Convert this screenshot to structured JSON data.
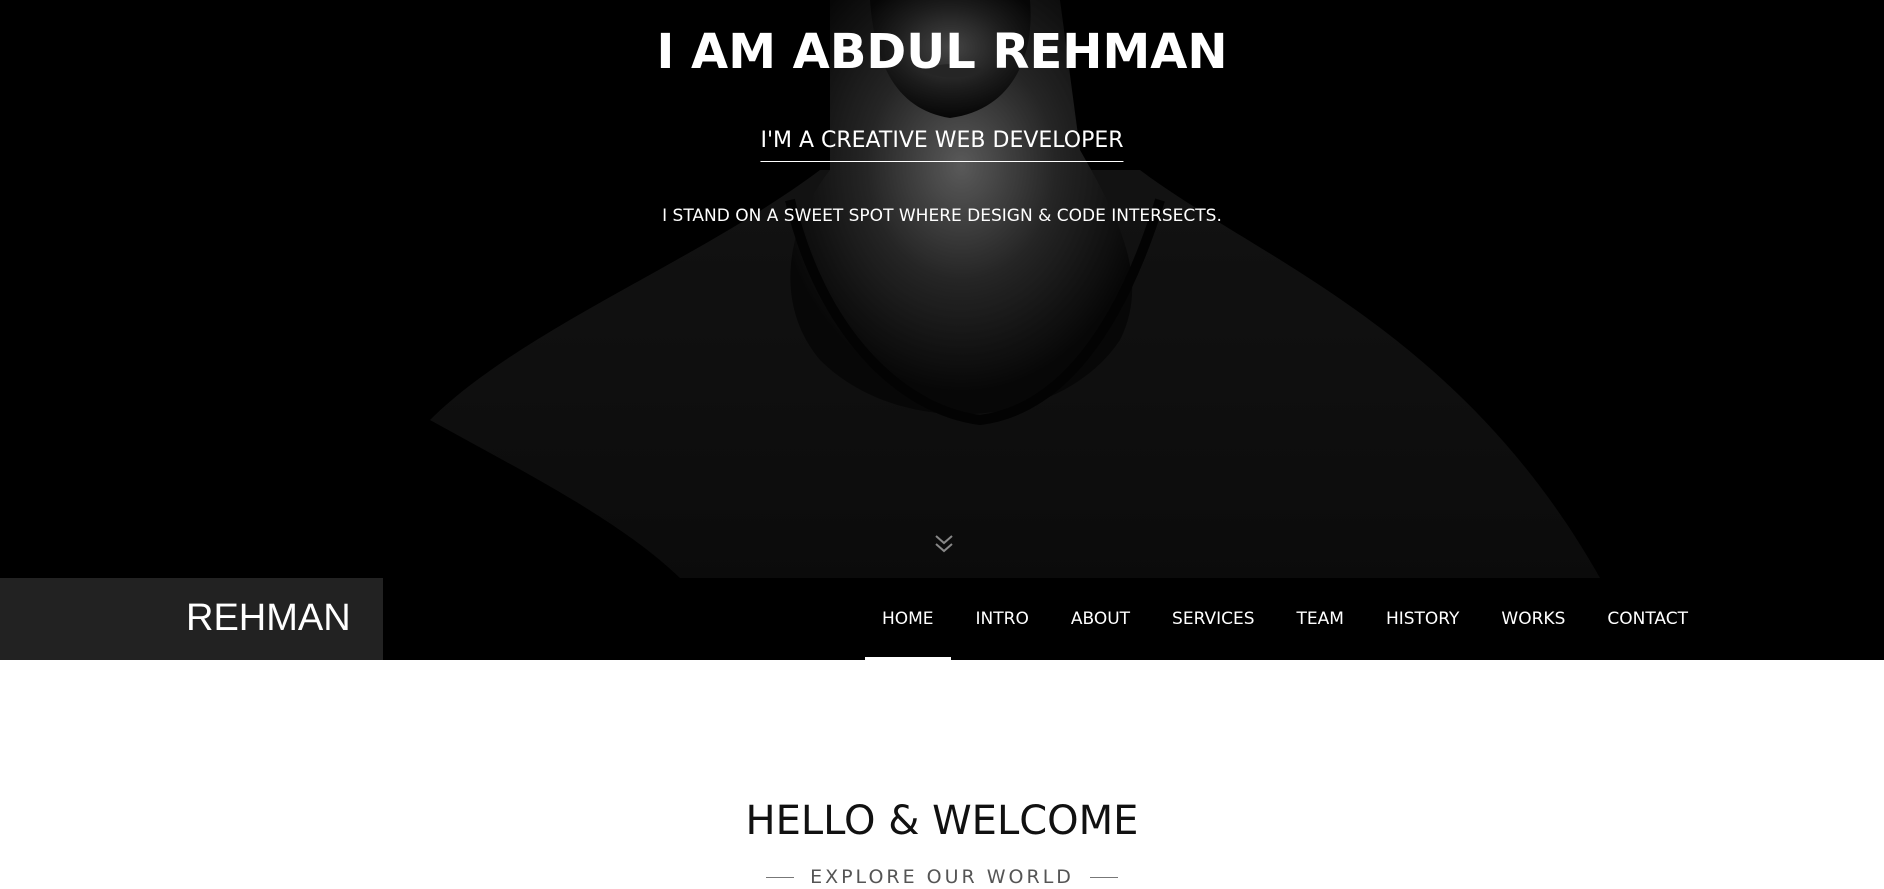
{
  "hero": {
    "title": "I AM ABDUL REHMAN",
    "subtitle": "I'M A CREATIVE WEB DEVELOPER",
    "tagline": "I STAND ON A SWEET SPOT WHERE DESIGN & CODE INTERSECTS.",
    "scroll_icon": "double-chevron-down-icon"
  },
  "navbar": {
    "brand": "REHMAN",
    "items": [
      {
        "label": "HOME",
        "active": true
      },
      {
        "label": "INTRO"
      },
      {
        "label": "ABOUT"
      },
      {
        "label": "SERVICES"
      },
      {
        "label": "TEAM"
      },
      {
        "label": "HISTORY"
      },
      {
        "label": "WORKS"
      },
      {
        "label": "CONTACT"
      }
    ]
  },
  "welcome": {
    "title": "HELLO & WELCOME",
    "subtitle": "EXPLORE OUR WORLD"
  },
  "colors": {
    "hero_bg": "#000000",
    "brand_box": "#222222",
    "nav_bg": "#000000",
    "text_light": "#ffffff",
    "text_dark": "#111111"
  }
}
